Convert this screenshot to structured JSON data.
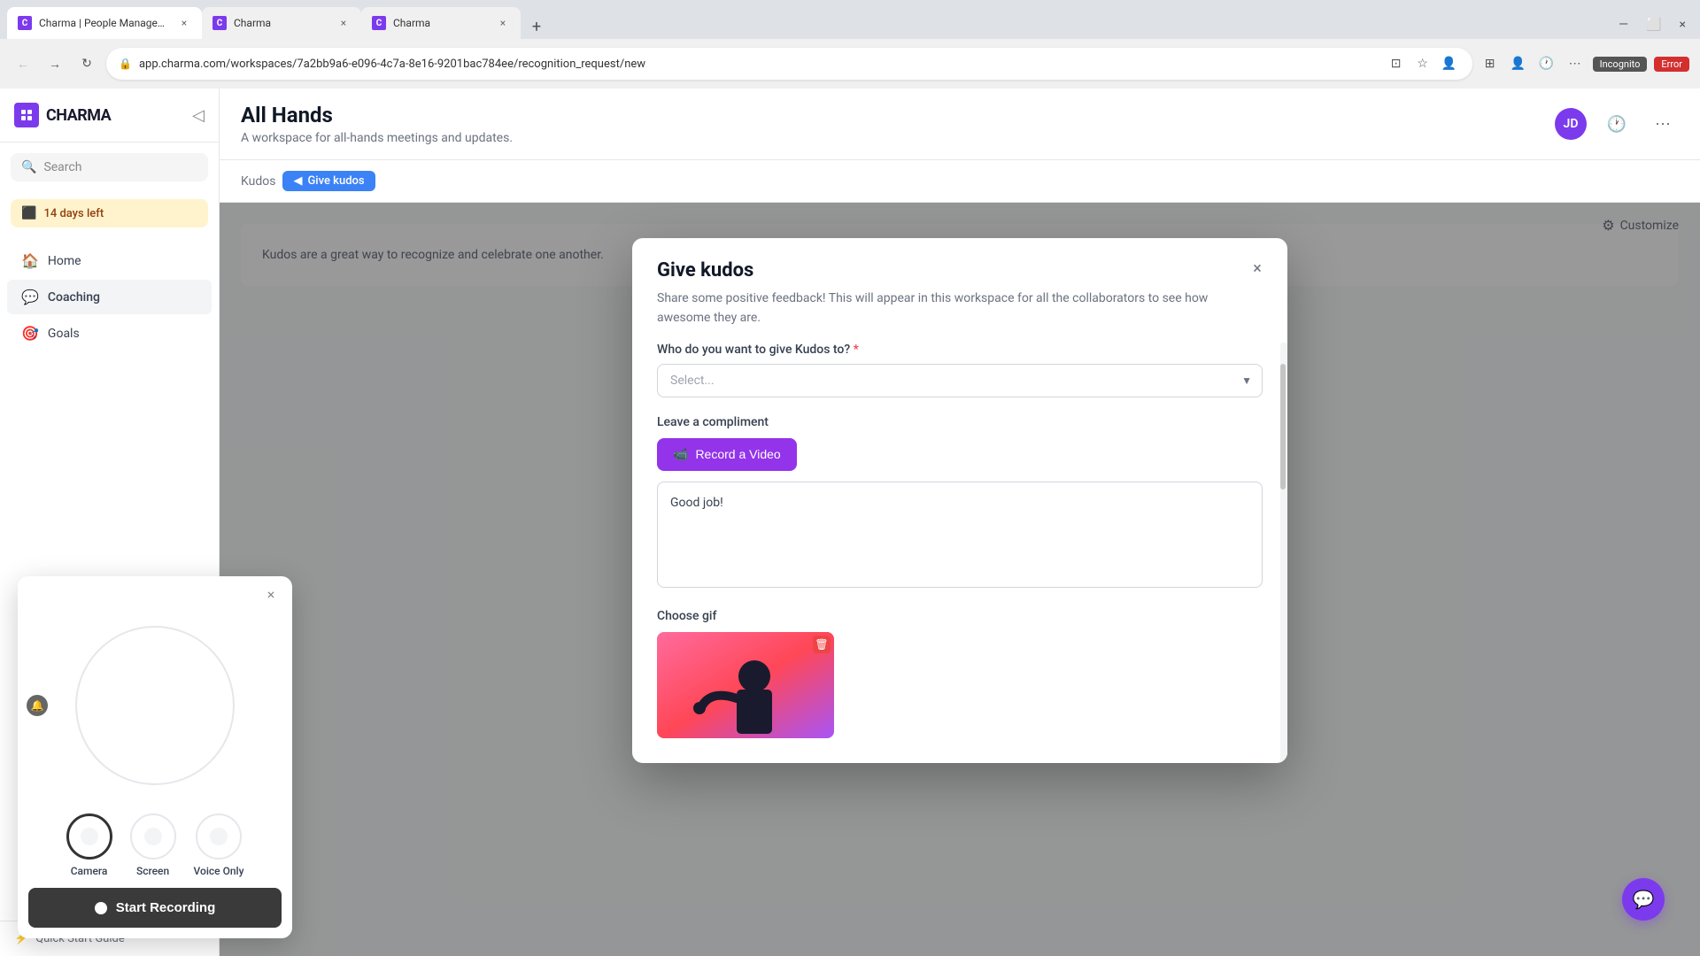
{
  "browser": {
    "tabs": [
      {
        "label": "Charma | People Management ...",
        "favicon_type": "charma",
        "active": true,
        "favicon_letter": "C"
      },
      {
        "label": "Charma",
        "favicon_type": "charma",
        "active": false,
        "favicon_letter": "C"
      },
      {
        "label": "Charma",
        "favicon_type": "charma",
        "active": false,
        "favicon_letter": "C"
      }
    ],
    "address": "app.charma.com/workspaces/7a2bb9a6-e096-4c7a-8e16-9201bac784ee/recognition_request/new",
    "incognito_label": "Incognito",
    "error_label": "Error"
  },
  "sidebar": {
    "logo_text": "CHARMA",
    "search_placeholder": "Search",
    "trial_text": "14 days left",
    "nav_items": [
      {
        "label": "Home",
        "icon": "🏠"
      },
      {
        "label": "Coaching",
        "icon": "💬"
      },
      {
        "label": "Goals",
        "icon": "🎯"
      }
    ],
    "quick_start": "Quick Start Guide"
  },
  "header": {
    "page_title": "All Hands",
    "page_subtitle": "A workspace for all-hands meetings and updates.",
    "customize_label": "Customize"
  },
  "breadcrumb": {
    "parent": "Kudos",
    "current": "Give kudos",
    "chevron": "◀"
  },
  "kudos_content": {
    "text": "Kudos are a great way to recognize and celebrate one another."
  },
  "modal": {
    "title": "Give kudos",
    "description": "Share some positive feedback! This will appear in this workspace for all the collaborators to see how awesome they are.",
    "who_label": "Who do you want to give Kudos to?",
    "select_placeholder": "Select...",
    "compliment_label": "Leave a compliment",
    "record_video_label": "Record a Video",
    "text_area_value": "Good job!",
    "gif_label": "Choose gif",
    "close_icon": "×"
  },
  "recording_widget": {
    "camera_label": "Camera",
    "screen_label": "Screen",
    "voice_only_label": "Voice Only",
    "start_recording_label": "Start Recording",
    "close_icon": "×"
  }
}
